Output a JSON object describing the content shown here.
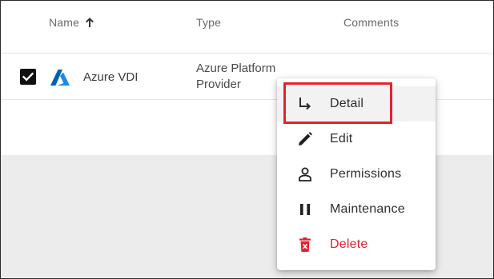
{
  "table": {
    "columns": [
      {
        "label": "Name",
        "sort_icon": "arrow-up-icon"
      },
      {
        "label": "Type"
      },
      {
        "label": "Comments"
      }
    ],
    "rows": [
      {
        "checked": true,
        "icon": "azure-logo-icon",
        "name": "Azure VDI",
        "type": "Azure Platform Provider",
        "comments": ""
      }
    ]
  },
  "context_menu": {
    "items": [
      {
        "label": "Detail",
        "icon": "subdirectory-arrow-icon",
        "highlighted": true
      },
      {
        "label": "Edit",
        "icon": "pencil-icon"
      },
      {
        "label": "Permissions",
        "icon": "person-icon"
      },
      {
        "label": "Maintenance",
        "icon": "pause-icon"
      },
      {
        "label": "Delete",
        "icon": "trash-icon",
        "danger": true
      }
    ]
  },
  "colors": {
    "accent_red": "#e0232e",
    "azure_blue": "#0078d4",
    "gray_background": "#ececec"
  }
}
